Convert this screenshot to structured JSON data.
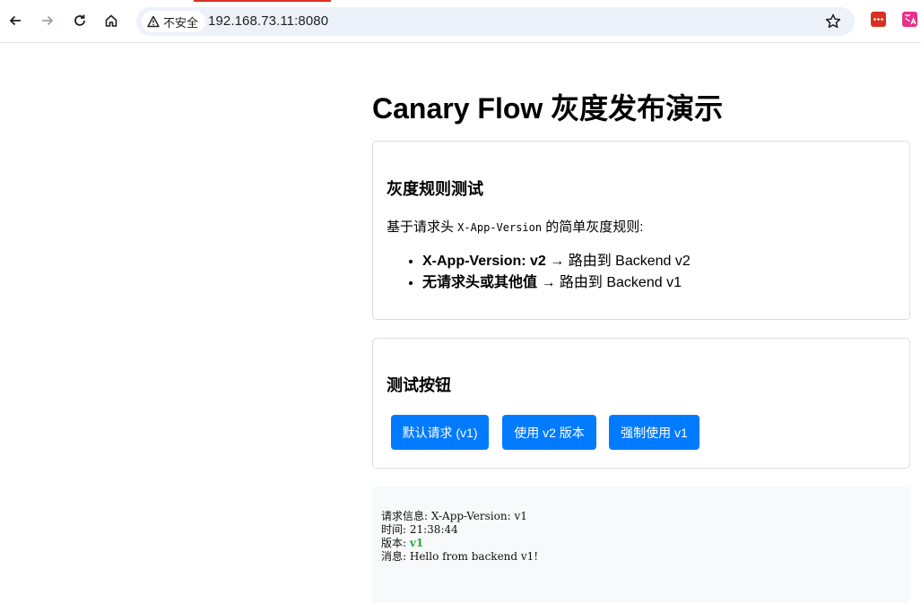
{
  "browser": {
    "security_label": "不安全",
    "url": "192.168.73.11:8080"
  },
  "page": {
    "title": "Canary Flow 灰度发布演示"
  },
  "rules_card": {
    "heading": "灰度规则测试",
    "desc_prefix": "基于请求头 ",
    "desc_code": "X-App-Version",
    "desc_suffix": " 的简单灰度规则:",
    "rules": [
      {
        "bold": "X-App-Version: v2",
        "text": " → 路由到 Backend v2"
      },
      {
        "bold": "无请求头或其他值",
        "text": " → 路由到 Backend v1"
      }
    ]
  },
  "buttons_card": {
    "heading": "测试按钮",
    "buttons": [
      {
        "label": "默认请求 (v1)"
      },
      {
        "label": "使用 v2 版本"
      },
      {
        "label": "强制使用 v1"
      }
    ]
  },
  "result": {
    "request_label": "请求信息: ",
    "request_value": "X-App-Version: v1",
    "time_label": "时间: ",
    "time_value": "21:38:44",
    "version_label": "版本: ",
    "version_value": "v1",
    "message_label": "消息: ",
    "message_value": "Hello from backend v1!"
  },
  "colors": {
    "button_bg": "#007bff",
    "version_green": "#28a745",
    "result_bg": "#f8f9fa",
    "card_border": "#dddddd"
  }
}
